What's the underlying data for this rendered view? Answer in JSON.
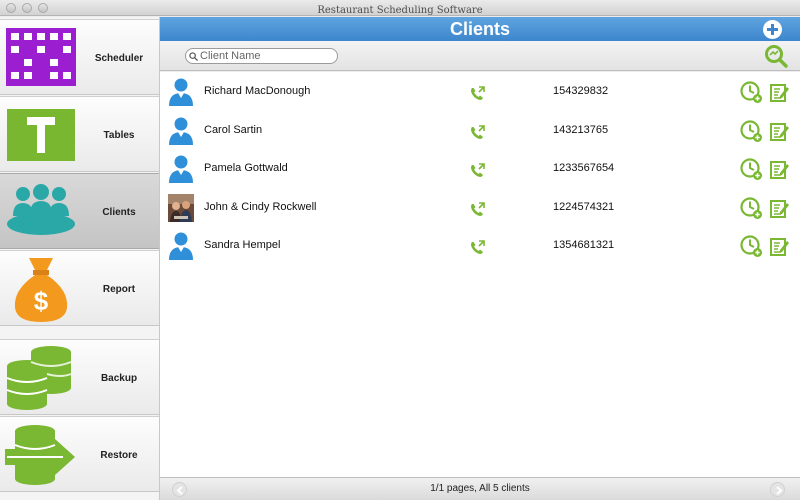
{
  "window": {
    "title": "Restaurant Scheduling Software"
  },
  "sidebar": {
    "items": [
      {
        "label": "Scheduler",
        "icon": "calendar-icon"
      },
      {
        "label": "Tables",
        "icon": "tables-icon"
      },
      {
        "label": "Clients",
        "icon": "clients-icon",
        "active": true
      },
      {
        "label": "Report",
        "icon": "money-bag-icon"
      },
      {
        "label": "Backup",
        "icon": "database-backup-icon"
      },
      {
        "label": "Restore",
        "icon": "database-restore-icon"
      }
    ]
  },
  "header": {
    "title": "Clients"
  },
  "search": {
    "placeholder": "Client Name",
    "value": ""
  },
  "clients": [
    {
      "name": "Richard MacDonough",
      "phone": "154329832",
      "avatar": "person-icon"
    },
    {
      "name": "Carol Sartin",
      "phone": "143213765",
      "avatar": "person-icon"
    },
    {
      "name": "Pamela Gottwald",
      "phone": "1233567654",
      "avatar": "person-icon"
    },
    {
      "name": "John & Cindy Rockwell",
      "phone": "1224574321",
      "avatar": "photo"
    },
    {
      "name": "Sandra Hempel",
      "phone": "1354681321",
      "avatar": "person-icon"
    }
  ],
  "footer": {
    "status": "1/1 pages, All 5 clients"
  },
  "colors": {
    "header_blue": "#4a93d6",
    "accent_green": "#7ab833",
    "avatar_blue": "#2f8fd8"
  }
}
